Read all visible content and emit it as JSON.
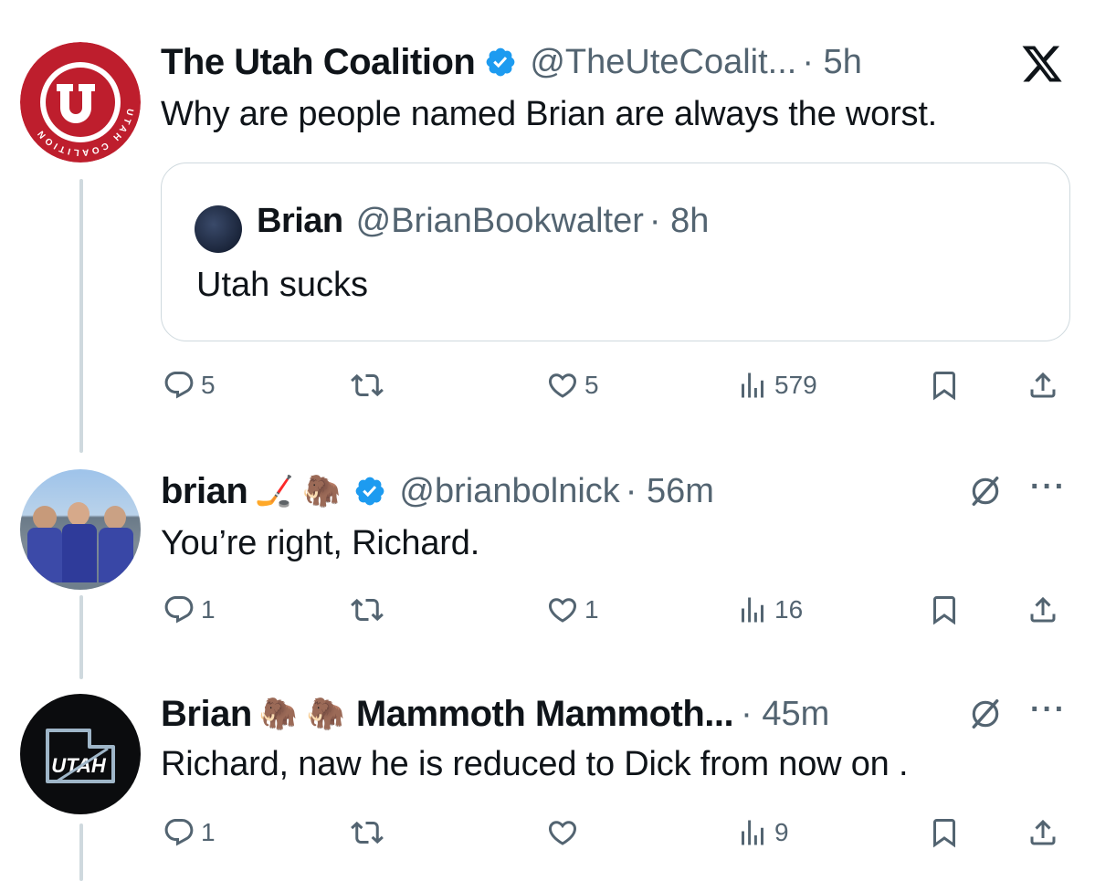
{
  "tweet1": {
    "name": "The Utah Coalition",
    "handle": "@TheUteCoalit...",
    "time": "· 5h",
    "text": "Why are people named Brian are always the worst.",
    "avatar_ring_text": "UTAH COALITION",
    "quote": {
      "name": "Brian",
      "handle": "@BrianBookwalter",
      "time": "· 8h",
      "text": "Utah sucks"
    },
    "actions": {
      "replies": "5",
      "reposts": "",
      "likes": "5",
      "views": "579"
    }
  },
  "tweet2": {
    "name": "brian",
    "emojis": "🏒 🦣",
    "handle": "@brianbolnick",
    "time": "· 56m",
    "text": "You’re right, Richard.",
    "actions": {
      "replies": "1",
      "reposts": "",
      "likes": "1",
      "views": "16"
    }
  },
  "tweet3": {
    "name": "Brian",
    "emojis": "🦣 🦣",
    "name2": "Mammoth Mammoth...",
    "time": "· 45m",
    "text": "Richard, naw he is reduced to Dick from now on .",
    "avatar_text": "UTAH",
    "actions": {
      "replies": "1",
      "reposts": "",
      "likes": "",
      "views": "9"
    }
  },
  "icons": {
    "verified": "verified-badge-icon",
    "x_logo": "x-logo-icon",
    "reply": "reply-icon",
    "repost": "repost-icon",
    "like": "heart-icon",
    "views": "views-icon",
    "bookmark": "bookmark-icon",
    "share": "share-icon",
    "grok": "grok-icon",
    "more": "more-icon"
  },
  "colors": {
    "accent_blue": "#1d9bf0",
    "text": "#0f1419",
    "muted": "#536471",
    "utah_red": "#be1e2d"
  }
}
